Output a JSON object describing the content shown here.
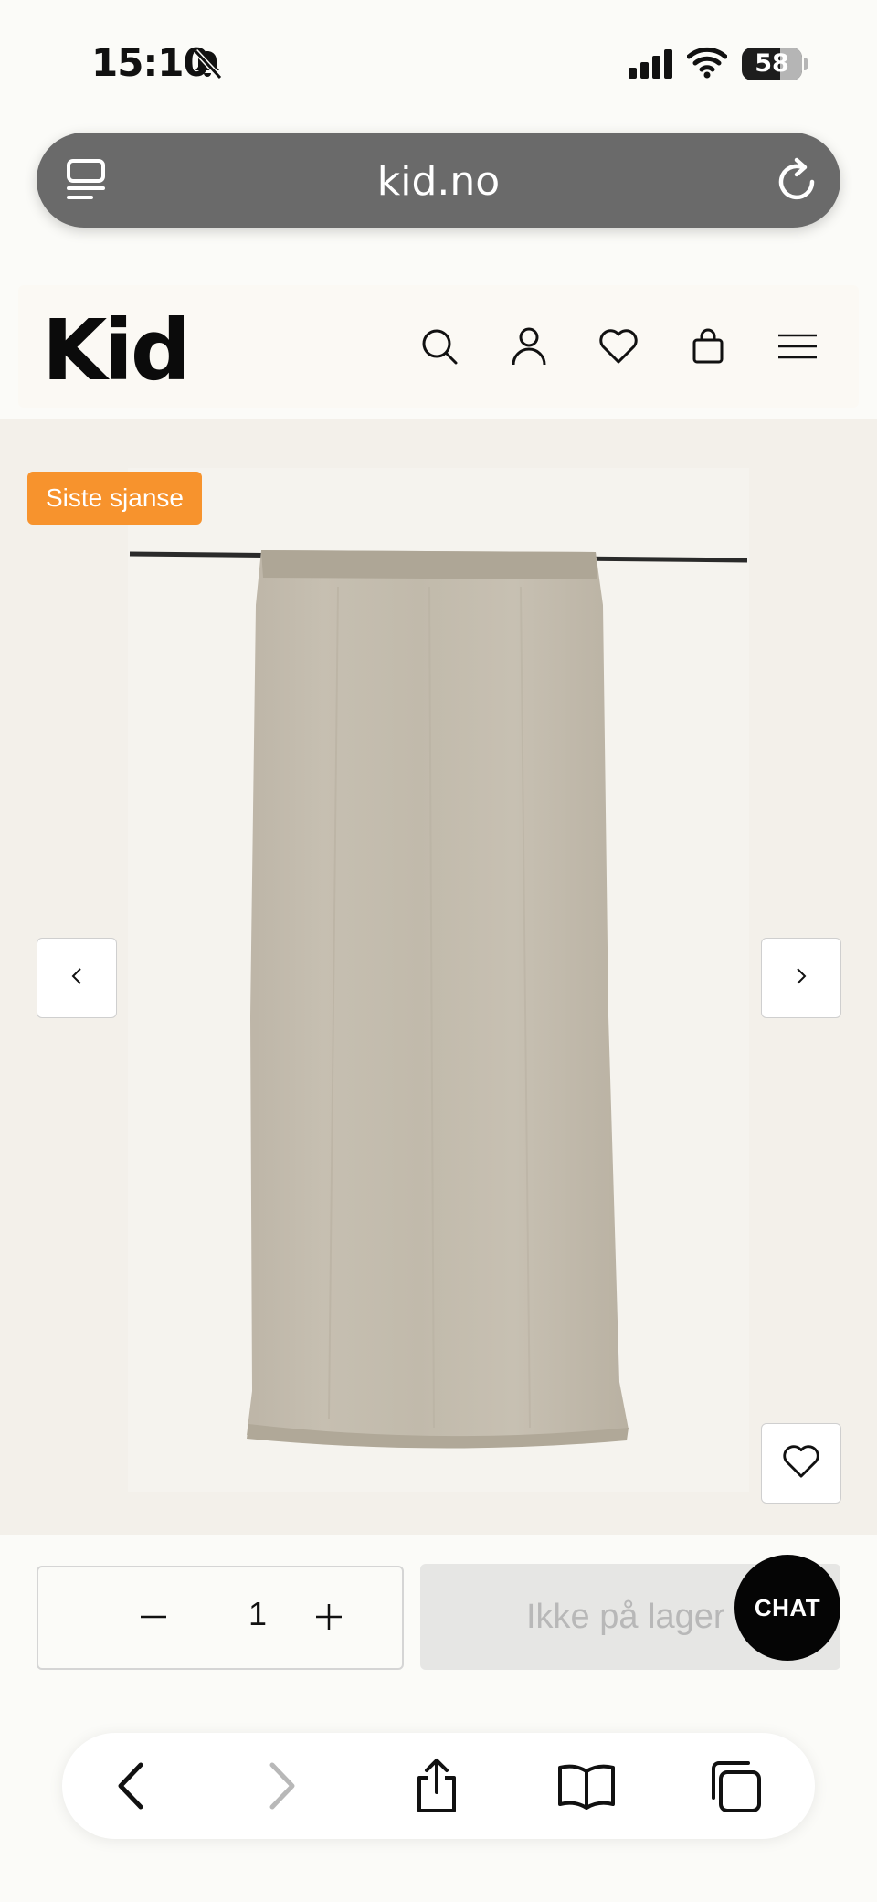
{
  "status_bar": {
    "time": "15:10",
    "battery_level": "58",
    "icons": [
      "bell-slash-icon",
      "cellular-signal-icon",
      "wifi-icon",
      "battery-icon"
    ]
  },
  "browser": {
    "url": "kid.no",
    "icons": [
      "tabs-icon",
      "reload-icon"
    ]
  },
  "site_header": {
    "logo": "Kid",
    "icons": [
      "search-icon",
      "account-icon",
      "wishlist-heart-icon",
      "shopping-bag-icon",
      "hamburger-menu-icon"
    ]
  },
  "product": {
    "badge": "Siste sjanse",
    "image": "linen-curtain-photo",
    "gallery_controls": [
      "chevron-left-icon",
      "chevron-right-icon",
      "heart-icon"
    ]
  },
  "purchase": {
    "quantity": "1",
    "button_label": "Ikke på lager",
    "chat_label": "CHAT"
  },
  "browser_toolbar": {
    "icons": [
      "back-arrow-icon",
      "forward-arrow-icon",
      "share-icon",
      "bookmarks-icon",
      "tabs-overview-icon"
    ]
  },
  "colors": {
    "badge_bg": "#f7932d",
    "chat_bg": "#050505",
    "urlbar_bg": "#6a6a6a",
    "disabled_button_bg": "#e6e6e4",
    "gallery_bg": "#f3f0ea"
  }
}
